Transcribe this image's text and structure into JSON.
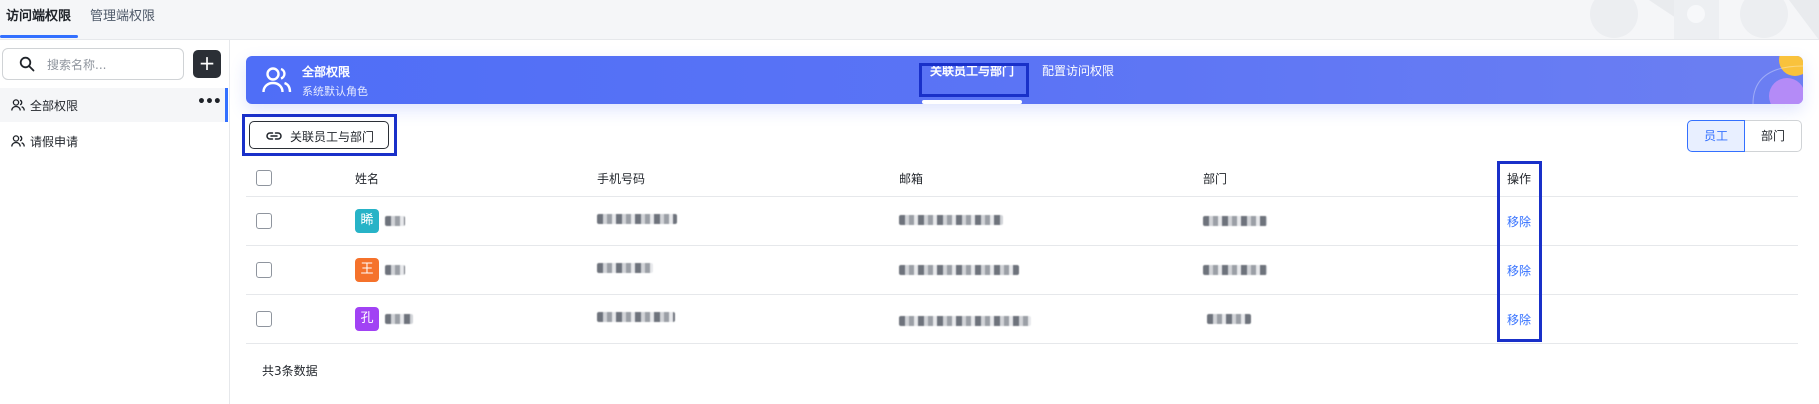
{
  "top_tabs": [
    {
      "label": "访问端权限"
    },
    {
      "label": "管理端权限"
    }
  ],
  "sidebar": {
    "search_placeholder": "搜索名称...",
    "add_icon": "plus-icon",
    "items": [
      {
        "label": "全部权限",
        "icon": "users-icon",
        "active": true
      },
      {
        "label": "请假申请",
        "icon": "users-icon",
        "active": false
      }
    ]
  },
  "banner": {
    "icon": "users-icon",
    "title": "全部权限",
    "subtitle": "系统默认角色",
    "tabs": [
      {
        "label": "关联员工与部门",
        "active": true
      },
      {
        "label": "配置访问权限",
        "active": false
      }
    ]
  },
  "toolbar": {
    "link_button_label": "关联员工与部门",
    "link_icon": "link-icon",
    "segment": [
      {
        "label": "员工",
        "active": true
      },
      {
        "label": "部门",
        "active": false
      }
    ]
  },
  "table": {
    "headers": [
      "姓名",
      "手机号码",
      "邮箱",
      "部门",
      "操作"
    ],
    "rows": [
      {
        "avatar_char": "睎",
        "avatar_color": "#27b3c7",
        "action": "移除"
      },
      {
        "avatar_char": "王",
        "avatar_color": "#f5722b",
        "action": "移除"
      },
      {
        "avatar_char": "孔",
        "avatar_color": "#a142f4",
        "action": "移除"
      }
    ]
  },
  "footer": {
    "total_text": "共3条数据"
  },
  "colors": {
    "accent": "#3370ff",
    "banner": "#5b74f5",
    "highlight": "#1930c9"
  }
}
